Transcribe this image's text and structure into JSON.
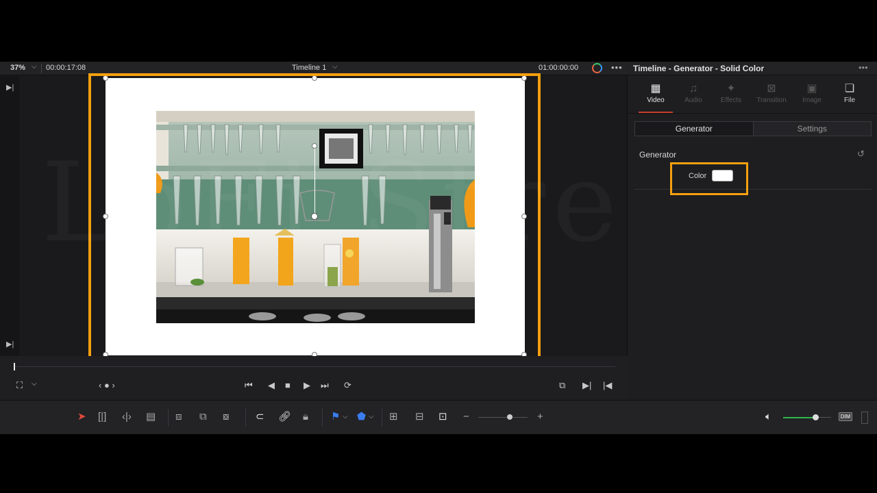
{
  "viewer": {
    "zoom": "37%",
    "timecode_left": "00:00:17:08",
    "timeline_name": "Timeline 1",
    "timecode_right": "01:00:00:00",
    "watermark": "LoFi Street"
  },
  "inspector": {
    "title": "Timeline - Generator - Solid Color",
    "tabs": [
      {
        "label": "Video",
        "icon": "film-icon",
        "active": true
      },
      {
        "label": "Audio",
        "icon": "music-note-icon",
        "active": false
      },
      {
        "label": "Effects",
        "icon": "magic-wand-icon",
        "active": false
      },
      {
        "label": "Transition",
        "icon": "transition-icon",
        "active": false
      },
      {
        "label": "Image",
        "icon": "image-icon",
        "active": false
      },
      {
        "label": "File",
        "icon": "file-icon",
        "active": false
      }
    ],
    "subtabs": [
      "Generator",
      "Settings"
    ],
    "section_title": "Generator",
    "color_label": "Color",
    "color_value": "#FFFFFF"
  },
  "colors": {
    "highlight": "#F5A00F",
    "accent_red": "#C8402E",
    "volume_green": "#2EB84B",
    "flag_blue": "#3A7DF0"
  },
  "toolbar": {
    "dim_label": "DIM"
  }
}
